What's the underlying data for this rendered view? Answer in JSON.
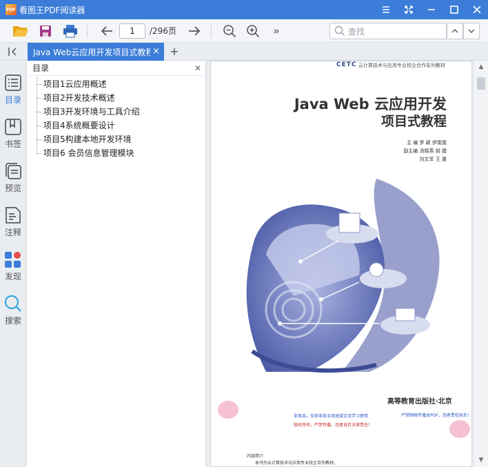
{
  "titlebar": {
    "title": "看图王PDF阅读器",
    "app_icon_text": "PDF",
    "controls": [
      "menu-icon",
      "fullscreen-icon",
      "minimize-icon",
      "maximize-icon",
      "close-icon"
    ]
  },
  "toolbar": {
    "page_current": "1",
    "page_total": "/296页",
    "more": "»",
    "search_placeholder": "查找"
  },
  "tabs": [
    {
      "label": "Java Web云应用开发项目式教程",
      "active": true
    }
  ],
  "rail": [
    {
      "label": "目录",
      "icon": "toc-icon"
    },
    {
      "label": "书签",
      "icon": "bookmark-icon"
    },
    {
      "label": "预览",
      "icon": "thumbnails-icon"
    },
    {
      "label": "注释",
      "icon": "annotation-icon"
    },
    {
      "label": "发现",
      "icon": "discover-icon"
    },
    {
      "label": "搜索",
      "icon": "search-icon"
    }
  ],
  "outline": {
    "header": "目录",
    "items": [
      "项目1云应用概述",
      "项目2开发技术概述",
      "项目3开发环境与工具介绍",
      "项目4系统概要设计",
      "项目5构建本地开发环境",
      "项目6 会员信息管理模块"
    ]
  },
  "page": {
    "cetc": "CETC",
    "series": "云计算技术与应用专业校企合作系列教材",
    "title_line1": "Java Web 云应用开发",
    "title_line2": "项目式教程",
    "authors_line1": "主 编  罗 颖  伊雯雯",
    "authors_line2": "副主编  汤晓燕  胡 霞",
    "authors_line3": "刘文军  王 肅",
    "publisher": "高等教育出版社·北京",
    "notice_blue": "非卖品，仅供非商业用途或交流学习使用",
    "notice_red": "版权所有，严禁传播，违者自负法律责任！",
    "notice_right": "严禁网络传播本PDF，违者责任自负！",
    "intro_heading": "内容简介",
    "intro_text": "本书为云计算技术与应用专业校企合作教材。"
  },
  "colors": {
    "accent": "#3b7dd8",
    "tab_bg": "#3b7dd8"
  }
}
